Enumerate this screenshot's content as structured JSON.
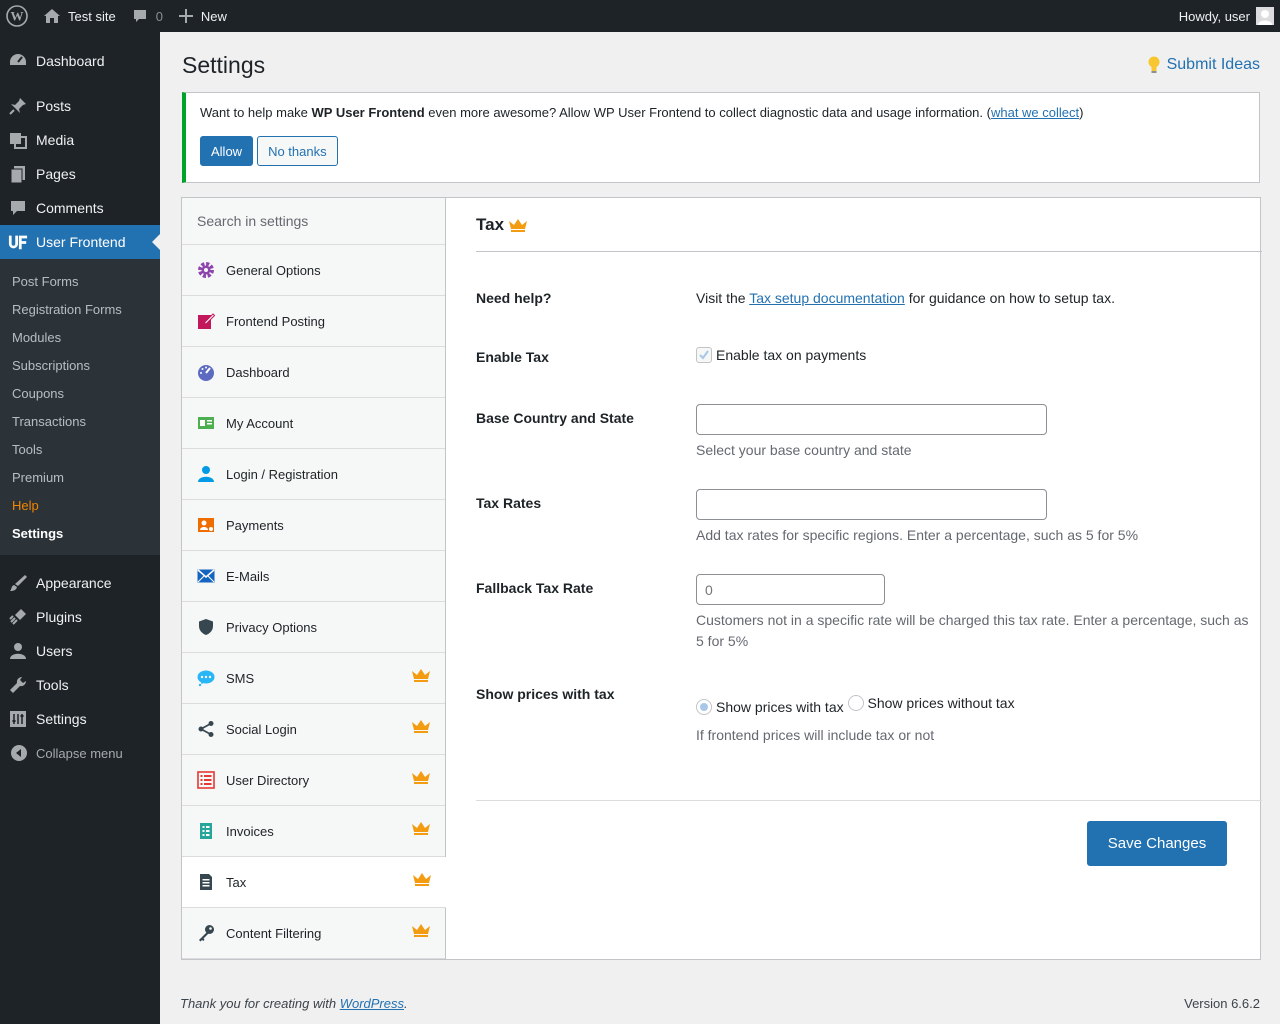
{
  "adminbar": {
    "site_name": "Test site",
    "comments_count": "0",
    "new_label": "New",
    "howdy": "Howdy, user"
  },
  "sidebar": {
    "top_items": [
      {
        "label": "Dashboard",
        "icon": "dashboard-icon"
      },
      {
        "label": "Posts",
        "icon": "pin-icon"
      },
      {
        "label": "Media",
        "icon": "media-icon"
      },
      {
        "label": "Pages",
        "icon": "pages-icon"
      },
      {
        "label": "Comments",
        "icon": "comment-icon"
      },
      {
        "label": "User Frontend",
        "icon": "user-frontend-icon"
      }
    ],
    "submenu": [
      "Post Forms",
      "Registration Forms",
      "Modules",
      "Subscriptions",
      "Coupons",
      "Transactions",
      "Tools",
      "Premium",
      "Help",
      "Settings"
    ],
    "bottom_items": [
      {
        "label": "Appearance",
        "icon": "brush-icon"
      },
      {
        "label": "Plugins",
        "icon": "plugin-icon"
      },
      {
        "label": "Users",
        "icon": "users-icon"
      },
      {
        "label": "Tools",
        "icon": "wrench-icon"
      },
      {
        "label": "Settings",
        "icon": "settings-icon"
      }
    ],
    "collapse": "Collapse menu"
  },
  "page": {
    "title": "Settings",
    "submit_ideas": "Submit Ideas"
  },
  "notice": {
    "text_before": "Want to help make ",
    "brand": "WP User Frontend",
    "text_after": " even more awesome? Allow WP User Frontend to collect diagnostic data and usage information. (",
    "link": "what we collect",
    "text_end": ")",
    "allow": "Allow",
    "no_thanks": "No thanks"
  },
  "nav": {
    "search_placeholder": "Search in settings",
    "items": [
      {
        "label": "General Options",
        "icon": "gear-icon",
        "color": "#8e44ad",
        "pro": false
      },
      {
        "label": "Frontend Posting",
        "icon": "edit-icon",
        "color": "#c2185b",
        "pro": false
      },
      {
        "label": "Dashboard",
        "icon": "gauge-icon",
        "color": "#5c6bc0",
        "pro": false
      },
      {
        "label": "My Account",
        "icon": "id-card-icon",
        "color": "#4caf50",
        "pro": false
      },
      {
        "label": "Login / Registration",
        "icon": "user-icon",
        "color": "#039be5",
        "pro": false
      },
      {
        "label": "Payments",
        "icon": "payment-icon",
        "color": "#ef6c00",
        "pro": false
      },
      {
        "label": "E-Mails",
        "icon": "envelope-icon",
        "color": "#1565c0",
        "pro": false
      },
      {
        "label": "Privacy Options",
        "icon": "shield-icon",
        "color": "#37474f",
        "pro": false
      },
      {
        "label": "SMS",
        "icon": "chat-icon",
        "color": "#29b6f6",
        "pro": true
      },
      {
        "label": "Social Login",
        "icon": "share-icon",
        "color": "#37474f",
        "pro": true
      },
      {
        "label": "User Directory",
        "icon": "list-icon",
        "color": "#e53935",
        "pro": true
      },
      {
        "label": "Invoices",
        "icon": "invoice-icon",
        "color": "#26a69a",
        "pro": true
      },
      {
        "label": "Tax",
        "icon": "document-icon",
        "color": "#37474f",
        "pro": true
      },
      {
        "label": "Content Filtering",
        "icon": "key-icon",
        "color": "#37474f",
        "pro": true
      }
    ],
    "crown_color": "#f39c12"
  },
  "panel": {
    "title": "Tax",
    "need_help": {
      "label": "Need help?",
      "before": "Visit the ",
      "link": "Tax setup documentation",
      "after": " for guidance on how to setup tax."
    },
    "enable_tax": {
      "label": "Enable Tax",
      "checkbox_label": "Enable tax on payments",
      "checked": true
    },
    "base_country": {
      "label": "Base Country and State",
      "value": "",
      "desc": "Select your base country and state"
    },
    "tax_rates": {
      "label": "Tax Rates",
      "value": "",
      "desc": "Add tax rates for specific regions. Enter a percentage, such as 5 for 5%"
    },
    "fallback": {
      "label": "Fallback Tax Rate",
      "placeholder": "0",
      "desc_line1": "Customers not in a specific rate will be charged this tax rate. Enter a percentage, such as",
      "desc_line2": "5 for 5%"
    },
    "show_prices": {
      "label": "Show prices with tax",
      "option_with": "Show prices with tax",
      "option_without": "Show prices without tax",
      "desc": "If frontend prices will include tax or not"
    },
    "save": "Save Changes"
  },
  "footer": {
    "thanks_before": "Thank you for creating with ",
    "thanks_link": "WordPress",
    "thanks_after": ".",
    "version": "Version 6.6.2"
  },
  "colors": {
    "accent": "#2271b1",
    "admin_dark": "#1d2327",
    "notice_green": "#00a32a",
    "help_orange": "#f18500"
  }
}
